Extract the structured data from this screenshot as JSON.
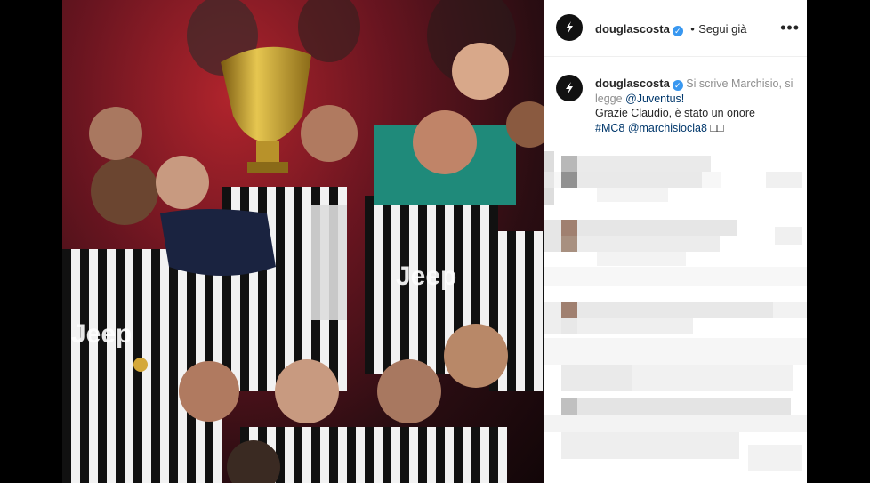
{
  "post": {
    "username": "douglascosta",
    "verified_mark": "✓",
    "header_separator": "•",
    "follow_status": "Segui già",
    "more_label": "•••",
    "caption": {
      "username": "douglascosta",
      "line1": "Si scrive Marchisio, si legge",
      "mention_team": "@Juventus!",
      "line2": "Grazie Claudio, è stato un onore",
      "hashtag": "#MC8",
      "mention_player": "@marchisiocla8",
      "trailing": "□□"
    }
  },
  "icons": {
    "avatar": "lightning-logo-icon",
    "verified": "verified-badge-icon",
    "more": "more-options-icon"
  },
  "colors": {
    "verified": "#3897f0",
    "link": "#00376b",
    "text": "#262626"
  }
}
